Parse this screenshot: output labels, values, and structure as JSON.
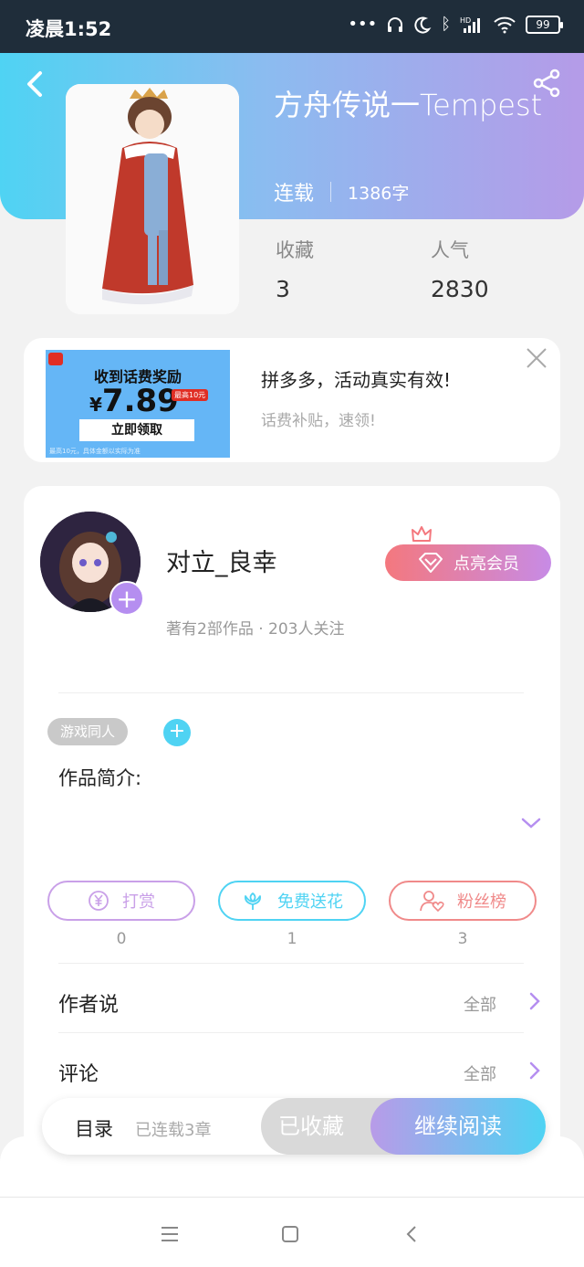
{
  "status_bar": {
    "time": "凌晨1:52",
    "network": "HD",
    "battery": "99"
  },
  "book": {
    "title": "方舟传说一Tempest",
    "status": "连载",
    "word_count": "1386字",
    "favorites_label": "收藏",
    "favorites_value": "3",
    "popularity_label": "人气",
    "popularity_value": "2830"
  },
  "ad": {
    "image_headline": "收到话费奖励",
    "image_price_symbol": "¥",
    "image_price": "7.89",
    "image_tag": "最高10元",
    "image_cta": "立即领取",
    "image_fine_print": "最高10元，具体金额以实际为准",
    "title": "拼多多，活动真实有效!",
    "subtitle": "话费补贴，速领!"
  },
  "author": {
    "name": "对立_良幸",
    "stats": "著有2部作品 · 203人关注",
    "vip_label": "点亮会员"
  },
  "tags": [
    "游戏同人"
  ],
  "intro_label": "作品简介:",
  "actions": [
    {
      "label": "打赏",
      "count": "0",
      "color": "#c9a0e8"
    },
    {
      "label": "免费送花",
      "count": "1",
      "color": "#4fd3f3"
    },
    {
      "label": "粉丝榜",
      "count": "3",
      "color": "#f08a8a"
    }
  ],
  "sections": [
    {
      "label": "作者说",
      "more": "全部"
    },
    {
      "label": "评论",
      "more": "全部"
    }
  ],
  "bottom_bar": {
    "toc_label": "目录",
    "chapters_label": "已连载3章",
    "collected_label": "已收藏",
    "read_label": "继续阅读"
  },
  "colors": {
    "accent_cyan": "#4fd3f3",
    "accent_purple": "#b89be8",
    "vip_pink": "#f4787e"
  }
}
